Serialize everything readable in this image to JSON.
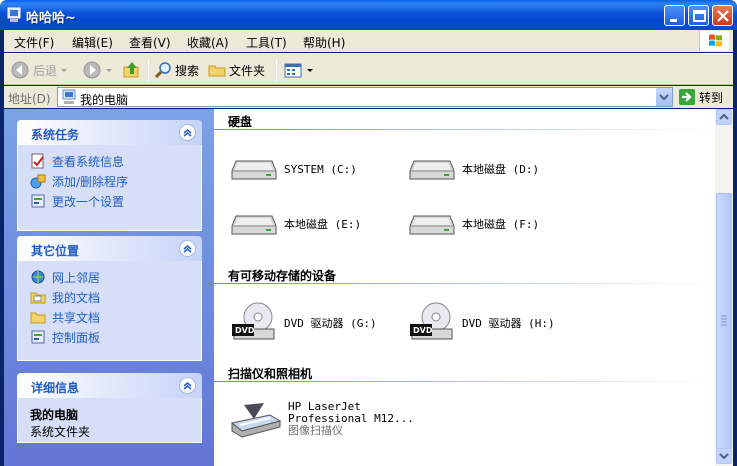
{
  "window": {
    "title": "哈哈哈~",
    "colors": {
      "title_bar": "#0a52d8",
      "task_pane": "#6375d6",
      "link": "#215dc6",
      "chrome": "#ece9d8"
    }
  },
  "menu": [
    {
      "label": "文件(F)"
    },
    {
      "label": "编辑(E)"
    },
    {
      "label": "查看(V)"
    },
    {
      "label": "收藏(A)"
    },
    {
      "label": "工具(T)"
    },
    {
      "label": "帮助(H)"
    }
  ],
  "toolbar": {
    "back_label": "后退",
    "search_label": "搜索",
    "folders_label": "文件夹"
  },
  "address": {
    "label": "地址(D)",
    "value": "我的电脑",
    "go_label": "转到"
  },
  "left_panels": {
    "system_tasks": {
      "title": "系统任务",
      "items": [
        {
          "label": "查看系统信息",
          "icon": "system-info-icon"
        },
        {
          "label": "添加/删除程序",
          "icon": "add-remove-icon"
        },
        {
          "label": "更改一个设置",
          "icon": "control-panel-icon"
        }
      ]
    },
    "other_places": {
      "title": "其它位置",
      "items": [
        {
          "label": "网上邻居",
          "icon": "network-icon"
        },
        {
          "label": "我的文档",
          "icon": "my-documents-icon"
        },
        {
          "label": "共享文档",
          "icon": "shared-folder-icon"
        },
        {
          "label": "控制面板",
          "icon": "control-panel-icon"
        }
      ]
    },
    "details": {
      "title": "详细信息",
      "name": "我的电脑",
      "type": "系统文件夹"
    }
  },
  "groups": {
    "hard_disks": {
      "title": "硬盘",
      "drives": [
        {
          "label": "SYSTEM (C:)"
        },
        {
          "label": "本地磁盘 (D:)"
        },
        {
          "label": "本地磁盘 (E:)"
        },
        {
          "label": "本地磁盘 (F:)"
        }
      ]
    },
    "removable": {
      "title": "有可移动存储的设备",
      "drives": [
        {
          "label": "DVD 驱动器 (G:)"
        },
        {
          "label": "DVD 驱动器 (H:)"
        }
      ]
    },
    "scanners": {
      "title": "扫描仪和照相机",
      "device": {
        "name_line1": "HP LaserJet",
        "name_line2": "Professional M12...",
        "type": "图像扫描仪"
      }
    }
  }
}
